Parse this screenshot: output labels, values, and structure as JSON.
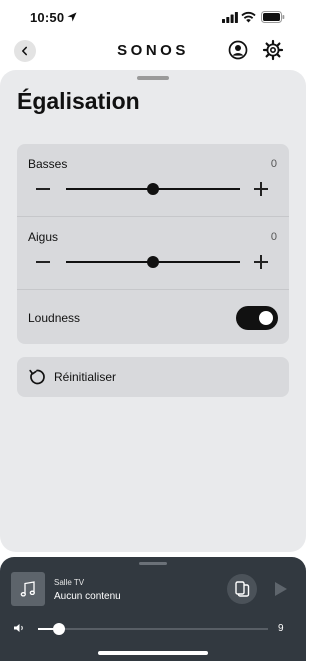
{
  "status_bar": {
    "time": "10:50",
    "location_icon": "location-arrow-icon",
    "signal_icon": "cellular-signal-icon",
    "wifi_icon": "wifi-icon",
    "battery_icon": "battery-icon"
  },
  "nav": {
    "back_icon": "chevron-left-icon",
    "brand": "SONOS",
    "account_icon": "account-icon",
    "settings_icon": "gear-icon"
  },
  "page": {
    "title": "Égalisation"
  },
  "equalizer": {
    "bass": {
      "label": "Basses",
      "value": "0",
      "level": 0
    },
    "treble": {
      "label": "Aigus",
      "value": "0",
      "level": 0
    },
    "level_range": [
      -10,
      10
    ],
    "loudness": {
      "label": "Loudness",
      "enabled": true
    }
  },
  "reset": {
    "label": "Réinitialiser",
    "icon": "reset-icon"
  },
  "player": {
    "room": "Salle TV",
    "track": "Aucun contenu",
    "album_icon": "music-note-icon",
    "group_icon": "speaker-group-icon",
    "play_icon": "play-icon",
    "volume_icon": "volume-icon",
    "volume": 9,
    "volume_max": 100
  },
  "colors": {
    "sheet": "#e9eaec",
    "card": "#d8d9dc",
    "accent": "#111111",
    "player_bg": "#323940"
  }
}
